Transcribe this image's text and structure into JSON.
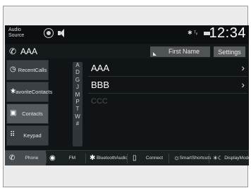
{
  "status": {
    "audio_source_line1": "Audio",
    "audio_source_line2": "Source",
    "clock": "12:34"
  },
  "header": {
    "contact": "AAA",
    "sort_button": "First Name",
    "settings_button": "Settings"
  },
  "sidebar": {
    "items": [
      {
        "line1": "Recent",
        "line2": "Calls",
        "icon": "clock-icon"
      },
      {
        "line1": "Favorite",
        "line2": "Contacts",
        "icon": "star-icon"
      },
      {
        "line1": "Contacts",
        "line2": "",
        "icon": "contact-book-icon"
      },
      {
        "line1": "Keypad",
        "line2": "",
        "icon": "keypad-icon"
      }
    ]
  },
  "alphabet": [
    "A",
    "D",
    "G",
    "J",
    "M",
    "P",
    "T",
    "W",
    "#"
  ],
  "contacts": [
    {
      "name": "AAA"
    },
    {
      "name": "BBB"
    },
    {
      "name": "CCC"
    }
  ],
  "bottom": {
    "items": [
      {
        "line1": "Phone",
        "line2": "",
        "icon": "phone-icon"
      },
      {
        "line1": "FM",
        "line2": "",
        "icon": "radio-icon"
      },
      {
        "line1": "Bluetooth",
        "line2": "Audio",
        "icon": "bluetooth-icon"
      },
      {
        "line1": "Connect",
        "line2": "",
        "icon": "device-icon"
      },
      {
        "line1": "Smart",
        "line2": "Shortcuts",
        "icon": "sun-icon"
      },
      {
        "line1": "Display",
        "line2": "Mode",
        "icon": "display-mode-icon"
      }
    ]
  },
  "colors": {
    "screen_bg": "#101417",
    "active_tab": "#565b5f",
    "button_bg": "#4f5356"
  }
}
